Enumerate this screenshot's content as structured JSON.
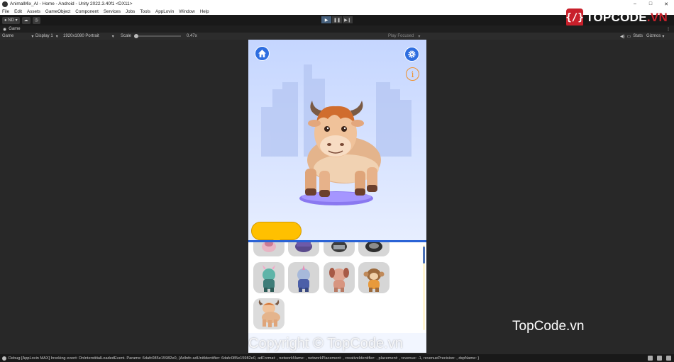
{
  "window": {
    "title": "AnimalMix_AI - Home - Android - Unity 2022.3.40f1 <DX11>"
  },
  "menu": [
    "File",
    "Edit",
    "Assets",
    "GameObject",
    "Component",
    "Services",
    "Jobs",
    "Tools",
    "AppLovin",
    "Window",
    "Help"
  ],
  "toolbar": {
    "account": "ND"
  },
  "logo": {
    "text": "TOPCODE",
    "suffix": ".VN",
    "mark": "{/}"
  },
  "tab": {
    "label": "Game",
    "more": "⋮"
  },
  "gamebar": {
    "view": "Game",
    "display": "Display 1",
    "resolution": "1920x1080 Portrait",
    "scale_label": "Scale",
    "scale_value": "0.47x",
    "play_mode": "Play Focused",
    "stats": "Stats",
    "gizmos": "Gizmos"
  },
  "game": {
    "info_glyph": "i",
    "animals_row2": [
      "dragon",
      "unicorn",
      "dog",
      "monkey"
    ],
    "animals_row3": [
      "bull"
    ]
  },
  "watermarks": {
    "side": "TopCode.vn",
    "bottom": "Copyright © TopCode.vn"
  },
  "status": {
    "message": "Debug [AppLovin MAX] Invoking event: OnInterstitialLoadedEvent. Params: 6dafc085e15982e0, {AdInfo adUnitIdentifier: 6dafc085e15982e0, adFormat: , networkName: , networkPlacement: , creativeIdentifier: , placement: , revenue: -1, revenuePrecision: , dspName: }"
  },
  "colors": {
    "accent_blue": "#2e6ee0",
    "bubble_yellow": "#ffc000",
    "info_orange": "#f0902a",
    "logo_red": "#c8202b"
  }
}
